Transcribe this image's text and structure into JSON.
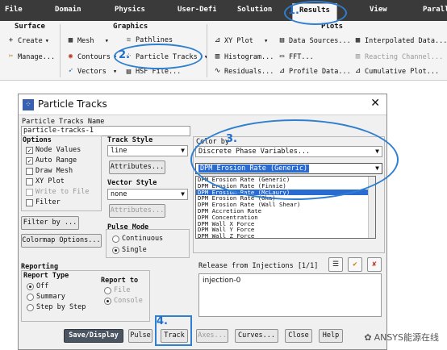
{
  "menubar": {
    "tabs": [
      "File",
      "Domain",
      "Physics",
      "User-Defined",
      "Solution",
      "Results",
      "View",
      "Parallel"
    ],
    "active": "Results"
  },
  "ribbon": {
    "surface": {
      "title": "Surface",
      "create": "Create",
      "manage": "Manage..."
    },
    "graphics": {
      "title": "Graphics",
      "mesh": "Mesh",
      "contours": "Contours",
      "vectors": "Vectors",
      "pathlines": "Pathlines",
      "particle_tracks": "Particle Tracks",
      "hsf": "HSF File..."
    },
    "plots": {
      "title": "Plots",
      "xy_plot": "XY Plot",
      "histogram": "Histogram...",
      "residuals": "Residuals...",
      "data_sources": "Data Sources...",
      "fft": "FFT...",
      "profile_data": "Profile Data...",
      "interpolated_data": "Interpolated Data...",
      "reacting_channel": "Reacting Channel...",
      "cumulative_plot": "Cumulative Plot..."
    }
  },
  "dialog": {
    "title": "Particle Tracks",
    "name_label": "Particle Tracks Name",
    "name_value": "particle-tracks-1",
    "options": {
      "title": "Options",
      "items": [
        {
          "label": "Node Values",
          "checked": true,
          "enabled": true
        },
        {
          "label": "Auto Range",
          "checked": true,
          "enabled": true
        },
        {
          "label": "Draw Mesh",
          "checked": false,
          "enabled": true
        },
        {
          "label": "XY Plot",
          "checked": false,
          "enabled": true
        },
        {
          "label": "Write to File",
          "checked": false,
          "enabled": false
        },
        {
          "label": "Filter",
          "checked": false,
          "enabled": true
        }
      ]
    },
    "filter_button": "Filter by ...",
    "colormap_button": "Colormap Options...",
    "track_style": {
      "title": "Track Style",
      "value": "line",
      "attributes": "Attributes..."
    },
    "vector_style": {
      "title": "Vector Style",
      "value": "none",
      "attributes": "Attributes..."
    },
    "pulse_mode": {
      "title": "Pulse Mode",
      "continuous": "Continuous",
      "single": "Single",
      "selected": "Single"
    },
    "color_by": {
      "title": "Color by",
      "category": "Discrete Phase Variables...",
      "field": "DPM Erosion Rate (Generic)",
      "list": [
        "DPM Erosion Rate (Generic)",
        "DPM Erosion Rate (Finnie)",
        "DPM Erosion Rate (McLaury)",
        "DPM Erosion Rate (Oka)",
        "DPM Erosion Rate (Wall Shear)",
        "DPM Accretion Rate",
        "DPM Concentration",
        "DPM Wall X Force",
        "DPM Wall Y Force",
        "DPM Wall Z Force"
      ],
      "selected_index": 2
    },
    "reporting": {
      "title": "Reporting",
      "report_type": {
        "title": "Report Type",
        "off": "Off",
        "summary": "Summary",
        "step": "Step by Step",
        "selected": "Off"
      },
      "report_to": {
        "title": "Report to",
        "file": "File",
        "console": "Console",
        "selected": "Console"
      }
    },
    "release": {
      "title": "Release from Injections [1/1]",
      "items": [
        "injection-0"
      ]
    },
    "buttons": {
      "save_display": "Save/Display",
      "pulse": "Pulse",
      "track": "Track",
      "axes": "Axes...",
      "curves": "Curves...",
      "close": "Close",
      "help": "Help"
    }
  },
  "annotations": {
    "step1": "1.",
    "step2": "2.",
    "step3": "3.",
    "step4": "4."
  },
  "watermark": "ANSYS能源在线",
  "colors": {
    "accent": "#2f7fd0",
    "selection": "#2a6bd1",
    "menubar": "#3a3a3a",
    "default_button": "#4a5561"
  }
}
